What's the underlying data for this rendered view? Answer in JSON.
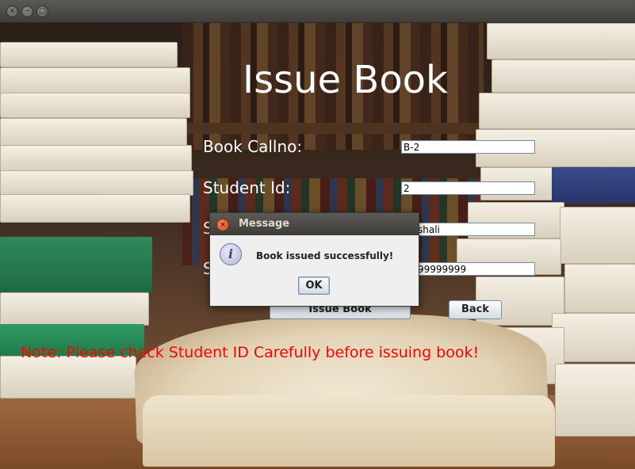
{
  "window": {
    "controls": [
      "close",
      "minimize",
      "maximize"
    ]
  },
  "form": {
    "title": "Issue Book",
    "book_callno_label": "Book Callno:",
    "book_callno_value": "B-2",
    "student_id_label": "Student Id:",
    "student_id_value": "2",
    "student_name_label_visible": "S",
    "student_name_value_visible": "shali",
    "student_contact_label_visible": "S",
    "student_contact_value_visible": "99999999",
    "issue_button": "Issue Book",
    "back_button": "Back",
    "note": "Note: Please check Student ID Carefully before issuing book!"
  },
  "dialog": {
    "title": "Message",
    "message": "Book issued successfully!",
    "ok_button": "OK",
    "icon": "info-icon"
  },
  "colors": {
    "note": "#ff0000",
    "title_text": "#ffffff"
  }
}
